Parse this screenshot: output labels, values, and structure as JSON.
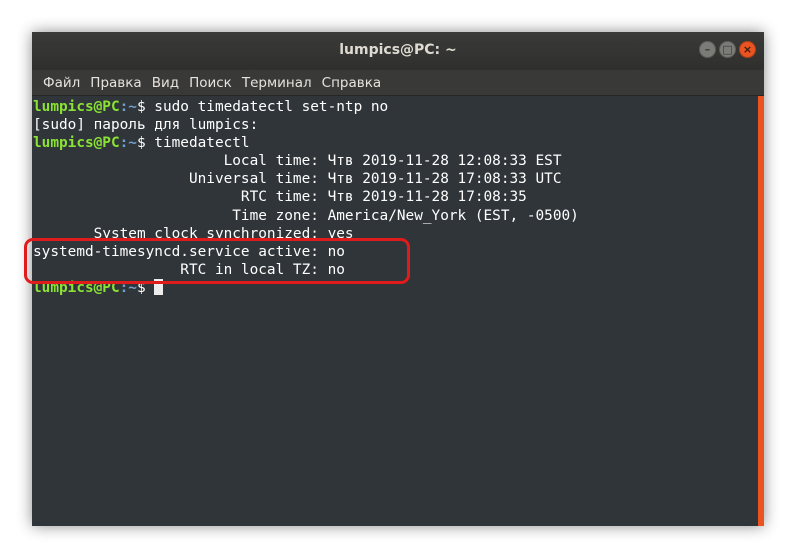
{
  "window": {
    "title": "lumpics@PC: ~",
    "buttons": {
      "minimize": "–",
      "maximize": "□",
      "close": "×"
    }
  },
  "menu": [
    {
      "label": "Файл"
    },
    {
      "label": "Правка"
    },
    {
      "label": "Вид"
    },
    {
      "label": "Поиск"
    },
    {
      "label": "Терминал"
    },
    {
      "label": "Справка"
    }
  ],
  "terminal": {
    "user_host": "lumpics@PC",
    "path": ":~",
    "prompt_symbol": "$ ",
    "command1": "sudo timedatectl set-ntp no",
    "sudo_prompt": "[sudo] пароль для lumpics:",
    "command2": "timedatectl",
    "output": [
      "                      Local time: Чтв 2019-11-28 12:08:33 EST",
      "                  Universal time: Чтв 2019-11-28 17:08:33 UTC",
      "                        RTC time: Чтв 2019-11-28 17:08:35",
      "                       Time zone: America/New_York (EST, -0500)",
      "       System clock synchronized: yes",
      "systemd-timesyncd.service active: no",
      "                 RTC in local TZ: no"
    ]
  },
  "colors": {
    "accent": "#e95420",
    "prompt_user": "#8ae234",
    "prompt_path": "#729fcf",
    "terminal_bg": "#2f3539",
    "highlight": "#e01b1b"
  }
}
